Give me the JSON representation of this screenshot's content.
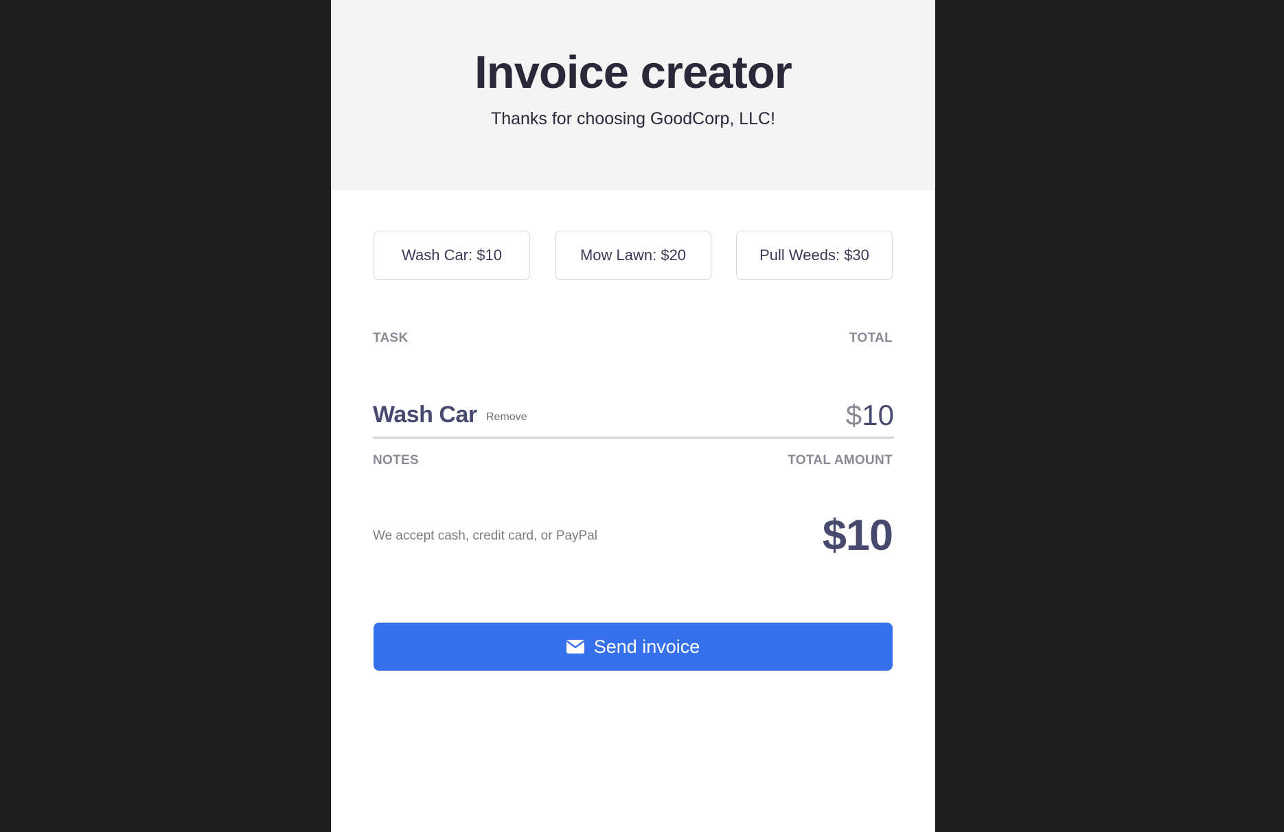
{
  "header": {
    "title": "Invoice creator",
    "subtitle": "Thanks for choosing GoodCorp, LLC!"
  },
  "services": [
    {
      "label": "Wash Car: $10"
    },
    {
      "label": "Mow Lawn: $20"
    },
    {
      "label": "Pull Weeds: $30"
    }
  ],
  "table": {
    "task_header": "TASK",
    "total_header": "TOTAL",
    "rows": [
      {
        "task": "Wash Car",
        "remove_label": "Remove",
        "currency": "$",
        "amount": "10"
      }
    ]
  },
  "footer": {
    "notes_header": "NOTES",
    "total_amount_header": "TOTAL AMOUNT",
    "notes_text": "We accept cash, credit card, or PayPal",
    "total_amount": "$10"
  },
  "send_button": {
    "label": "Send invoice",
    "icon": "mail-icon"
  },
  "colors": {
    "accent": "#3770eb",
    "header_bg": "#f4f4f4",
    "page_bg": "#1e1e1e",
    "text_dark": "#2b283a",
    "text_primary": "#474a6e",
    "text_muted": "#8a8a95"
  }
}
